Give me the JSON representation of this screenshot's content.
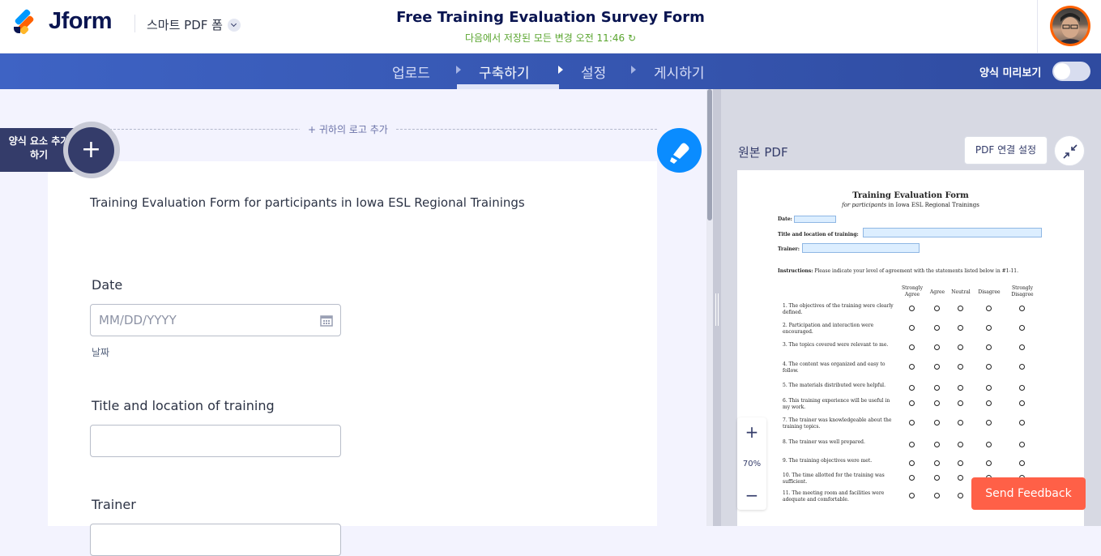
{
  "brand": {
    "name": "Jform"
  },
  "header": {
    "product": "스마트 PDF 폼",
    "title": "Free Training Evaluation Survey Form",
    "saved_status": "다음에서 저장된 모든 변경 오전 11:46"
  },
  "nav": {
    "tabs": [
      {
        "label": "업로드"
      },
      {
        "label": "구축하기"
      },
      {
        "label": "설정"
      },
      {
        "label": "게시하기"
      }
    ],
    "active": "구축하기",
    "preview_label": "양식 미리보기",
    "preview_on": false
  },
  "builder": {
    "add_logo": "+ 귀하의 로고 추가",
    "add_element": "양식 요소 추가하기",
    "intro": "Training Evaluation Form for participants in Iowa ESL Regional Trainings",
    "fields": [
      {
        "label": "Date",
        "placeholder": "MM/DD/YYYY",
        "sublabel": "날짜"
      },
      {
        "label": "Title and location of training",
        "placeholder": ""
      },
      {
        "label": "Trainer",
        "placeholder": ""
      }
    ]
  },
  "pdf_panel": {
    "title": "원본 PDF",
    "link_settings": "PDF 연결 설정",
    "zoom": "70%",
    "doc": {
      "title": "Training Evaluation Form",
      "subtitle_em": "for participants",
      "subtitle_rest": " in Iowa ESL Regional Trainings",
      "labels": [
        "Date:",
        "Title and location of training:",
        "Trainer:"
      ],
      "instructions_bold": "Instructions:",
      "instructions": " Please indicate your level of agreement with the statements listed below in #1-11.",
      "scale": [
        "Strongly Agree",
        "Agree",
        "Neutral",
        "Disagree",
        "Strongly Disagree"
      ],
      "statements": [
        "1. The objectives of the training were clearly defined.",
        "2. Participation and interaction were encouraged.",
        "3. The topics covered were relevant to me.",
        "4. The content was organized and easy to follow.",
        "5. The materials distributed were helpful.",
        "6. This training experience will be useful in my work.",
        "7. The trainer was knowledgeable about the training topics.",
        "8. The trainer was well prepared.",
        "9. The training objectives were met.",
        "10. The time allotted for the training was sufficient.",
        "11. The meeting room and facilities were adequate and comfortable."
      ]
    }
  },
  "feedback": {
    "label": "Send Feedback"
  },
  "colors": {
    "nav": "#3e63c4",
    "accent": "#0a8cff",
    "feedback": "#ff6047",
    "saved": "#5aa52f",
    "brand": "#0a1551"
  }
}
